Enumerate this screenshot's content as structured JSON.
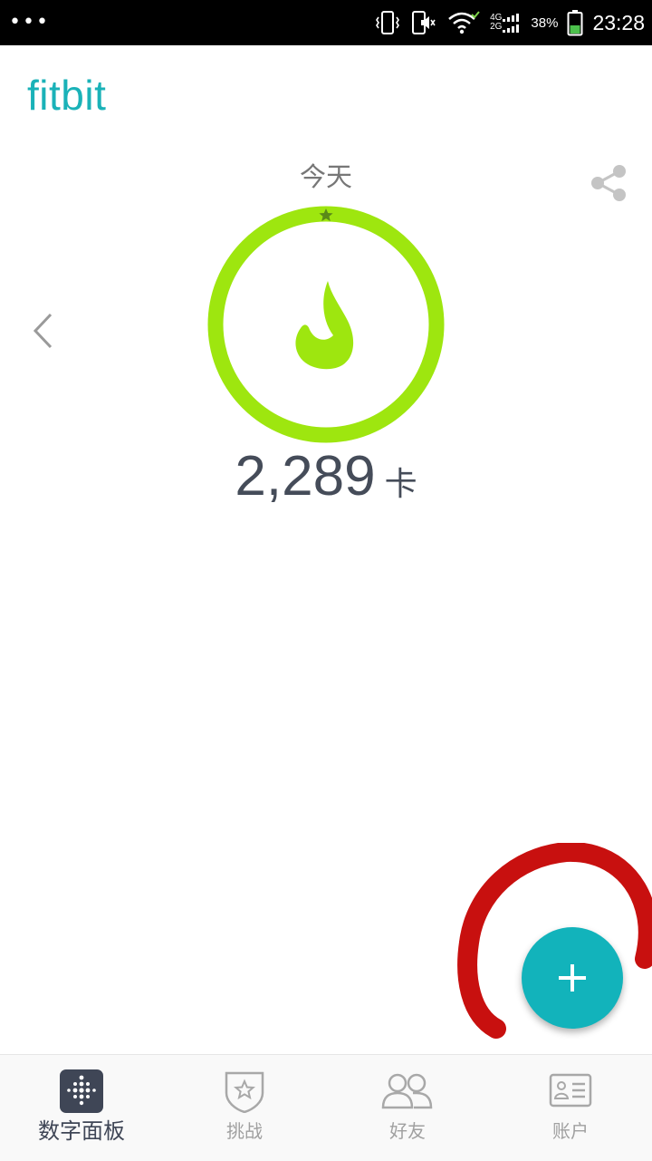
{
  "status_bar": {
    "dots": "•••",
    "network_top": "4G",
    "network_bottom": "2G",
    "battery_percent": "38%",
    "time": "23:28",
    "icons": [
      "vibrate-icon",
      "mute-icon",
      "wifi-icon",
      "signal-icon",
      "battery-icon"
    ]
  },
  "header": {
    "logo": "fitbit",
    "share_icon": "share-icon"
  },
  "dashboard": {
    "day_label": "今天",
    "value": "2,289",
    "unit": "卡",
    "ring_progress": 1.0,
    "ring_color": "#9ee60f",
    "icon": "flame-icon"
  },
  "fab": {
    "icon": "plus-icon",
    "color": "#12b3bb"
  },
  "bottom_nav": {
    "items": [
      {
        "label": "数字面板",
        "icon": "dashboard-icon",
        "active": true
      },
      {
        "label": "挑战",
        "icon": "challenge-icon",
        "active": false
      },
      {
        "label": "好友",
        "icon": "friends-icon",
        "active": false
      },
      {
        "label": "账户",
        "icon": "account-icon",
        "active": false
      }
    ]
  },
  "colors": {
    "brand": "#1ab2b8",
    "ring": "#9ee60f",
    "annotation": "#c8100f"
  }
}
